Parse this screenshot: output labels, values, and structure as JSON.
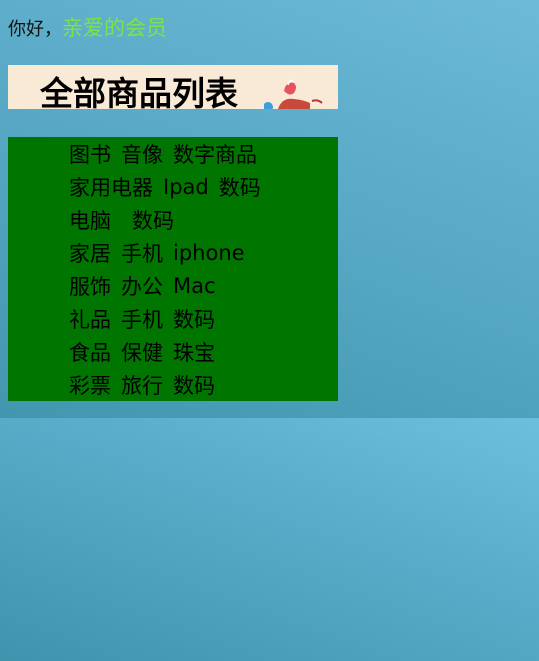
{
  "header": {
    "greeting": "你好，",
    "member_link": "亲爱的会员"
  },
  "banner": {
    "title": "全部商品列表"
  },
  "categories": [
    [
      "图书",
      "音像",
      "数字商品"
    ],
    [
      "家用电器",
      "Ipad",
      "数码"
    ],
    [
      "电脑",
      "数码"
    ],
    [
      "家居",
      "手机",
      "iphone"
    ],
    [
      "服饰",
      "办公",
      "Mac"
    ],
    [
      "礼品",
      "手机",
      "数码"
    ],
    [
      "食品",
      "保健",
      "珠宝"
    ],
    [
      "彩票",
      "旅行",
      "数码"
    ]
  ],
  "colors": {
    "panel": "#007500",
    "banner_bg": "#f9ead8",
    "member_link": "#7be34a"
  }
}
